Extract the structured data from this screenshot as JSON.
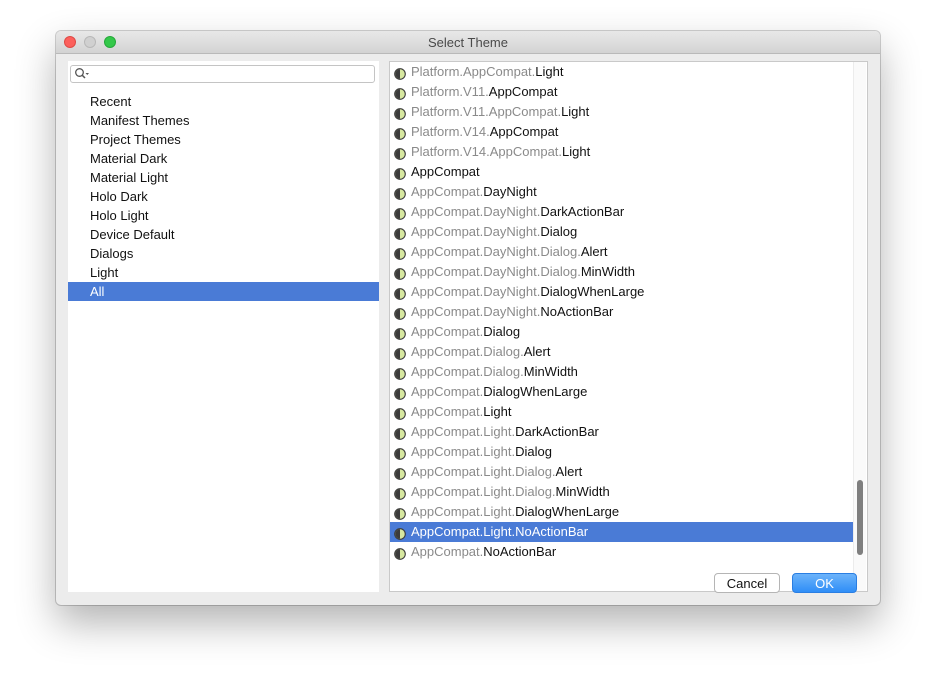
{
  "window": {
    "title": "Select Theme"
  },
  "search": {
    "value": "",
    "placeholder": ""
  },
  "categories": [
    {
      "label": "Recent",
      "selected": false
    },
    {
      "label": "Manifest Themes",
      "selected": false
    },
    {
      "label": "Project Themes",
      "selected": false
    },
    {
      "label": "Material Dark",
      "selected": false
    },
    {
      "label": "Material Light",
      "selected": false
    },
    {
      "label": "Holo Dark",
      "selected": false
    },
    {
      "label": "Holo Light",
      "selected": false
    },
    {
      "label": "Device Default",
      "selected": false
    },
    {
      "label": "Dialogs",
      "selected": false
    },
    {
      "label": "Light",
      "selected": false
    },
    {
      "label": "All",
      "selected": true
    }
  ],
  "themes": [
    {
      "prefix": "Platform.AppCompat.",
      "name": "Light",
      "selected": false
    },
    {
      "prefix": "Platform.V11.",
      "name": "AppCompat",
      "selected": false
    },
    {
      "prefix": "Platform.V11.AppCompat.",
      "name": "Light",
      "selected": false
    },
    {
      "prefix": "Platform.V14.",
      "name": "AppCompat",
      "selected": false
    },
    {
      "prefix": "Platform.V14.AppCompat.",
      "name": "Light",
      "selected": false
    },
    {
      "prefix": "",
      "name": "AppCompat",
      "selected": false
    },
    {
      "prefix": "AppCompat.",
      "name": "DayNight",
      "selected": false
    },
    {
      "prefix": "AppCompat.DayNight.",
      "name": "DarkActionBar",
      "selected": false
    },
    {
      "prefix": "AppCompat.DayNight.",
      "name": "Dialog",
      "selected": false
    },
    {
      "prefix": "AppCompat.DayNight.Dialog.",
      "name": "Alert",
      "selected": false
    },
    {
      "prefix": "AppCompat.DayNight.Dialog.",
      "name": "MinWidth",
      "selected": false
    },
    {
      "prefix": "AppCompat.DayNight.",
      "name": "DialogWhenLarge",
      "selected": false
    },
    {
      "prefix": "AppCompat.DayNight.",
      "name": "NoActionBar",
      "selected": false
    },
    {
      "prefix": "AppCompat.",
      "name": "Dialog",
      "selected": false
    },
    {
      "prefix": "AppCompat.Dialog.",
      "name": "Alert",
      "selected": false
    },
    {
      "prefix": "AppCompat.Dialog.",
      "name": "MinWidth",
      "selected": false
    },
    {
      "prefix": "AppCompat.",
      "name": "DialogWhenLarge",
      "selected": false
    },
    {
      "prefix": "AppCompat.",
      "name": "Light",
      "selected": false
    },
    {
      "prefix": "AppCompat.Light.",
      "name": "DarkActionBar",
      "selected": false
    },
    {
      "prefix": "AppCompat.Light.",
      "name": "Dialog",
      "selected": false
    },
    {
      "prefix": "AppCompat.Light.Dialog.",
      "name": "Alert",
      "selected": false
    },
    {
      "prefix": "AppCompat.Light.Dialog.",
      "name": "MinWidth",
      "selected": false
    },
    {
      "prefix": "AppCompat.Light.",
      "name": "DialogWhenLarge",
      "selected": false
    },
    {
      "prefix": "AppCompat.Light.",
      "name": "NoActionBar",
      "selected": true
    },
    {
      "prefix": "AppCompat.",
      "name": "NoActionBar",
      "selected": false
    }
  ],
  "buttons": {
    "cancel_label": "Cancel",
    "ok_label": "OK"
  },
  "icons": {
    "theme": "theme-icon",
    "search": "search-icon"
  },
  "colors": {
    "selection": "#4a7bd6",
    "ok_button": "#2f8ef7",
    "theme_icon_fill": "#d7e8a0"
  }
}
